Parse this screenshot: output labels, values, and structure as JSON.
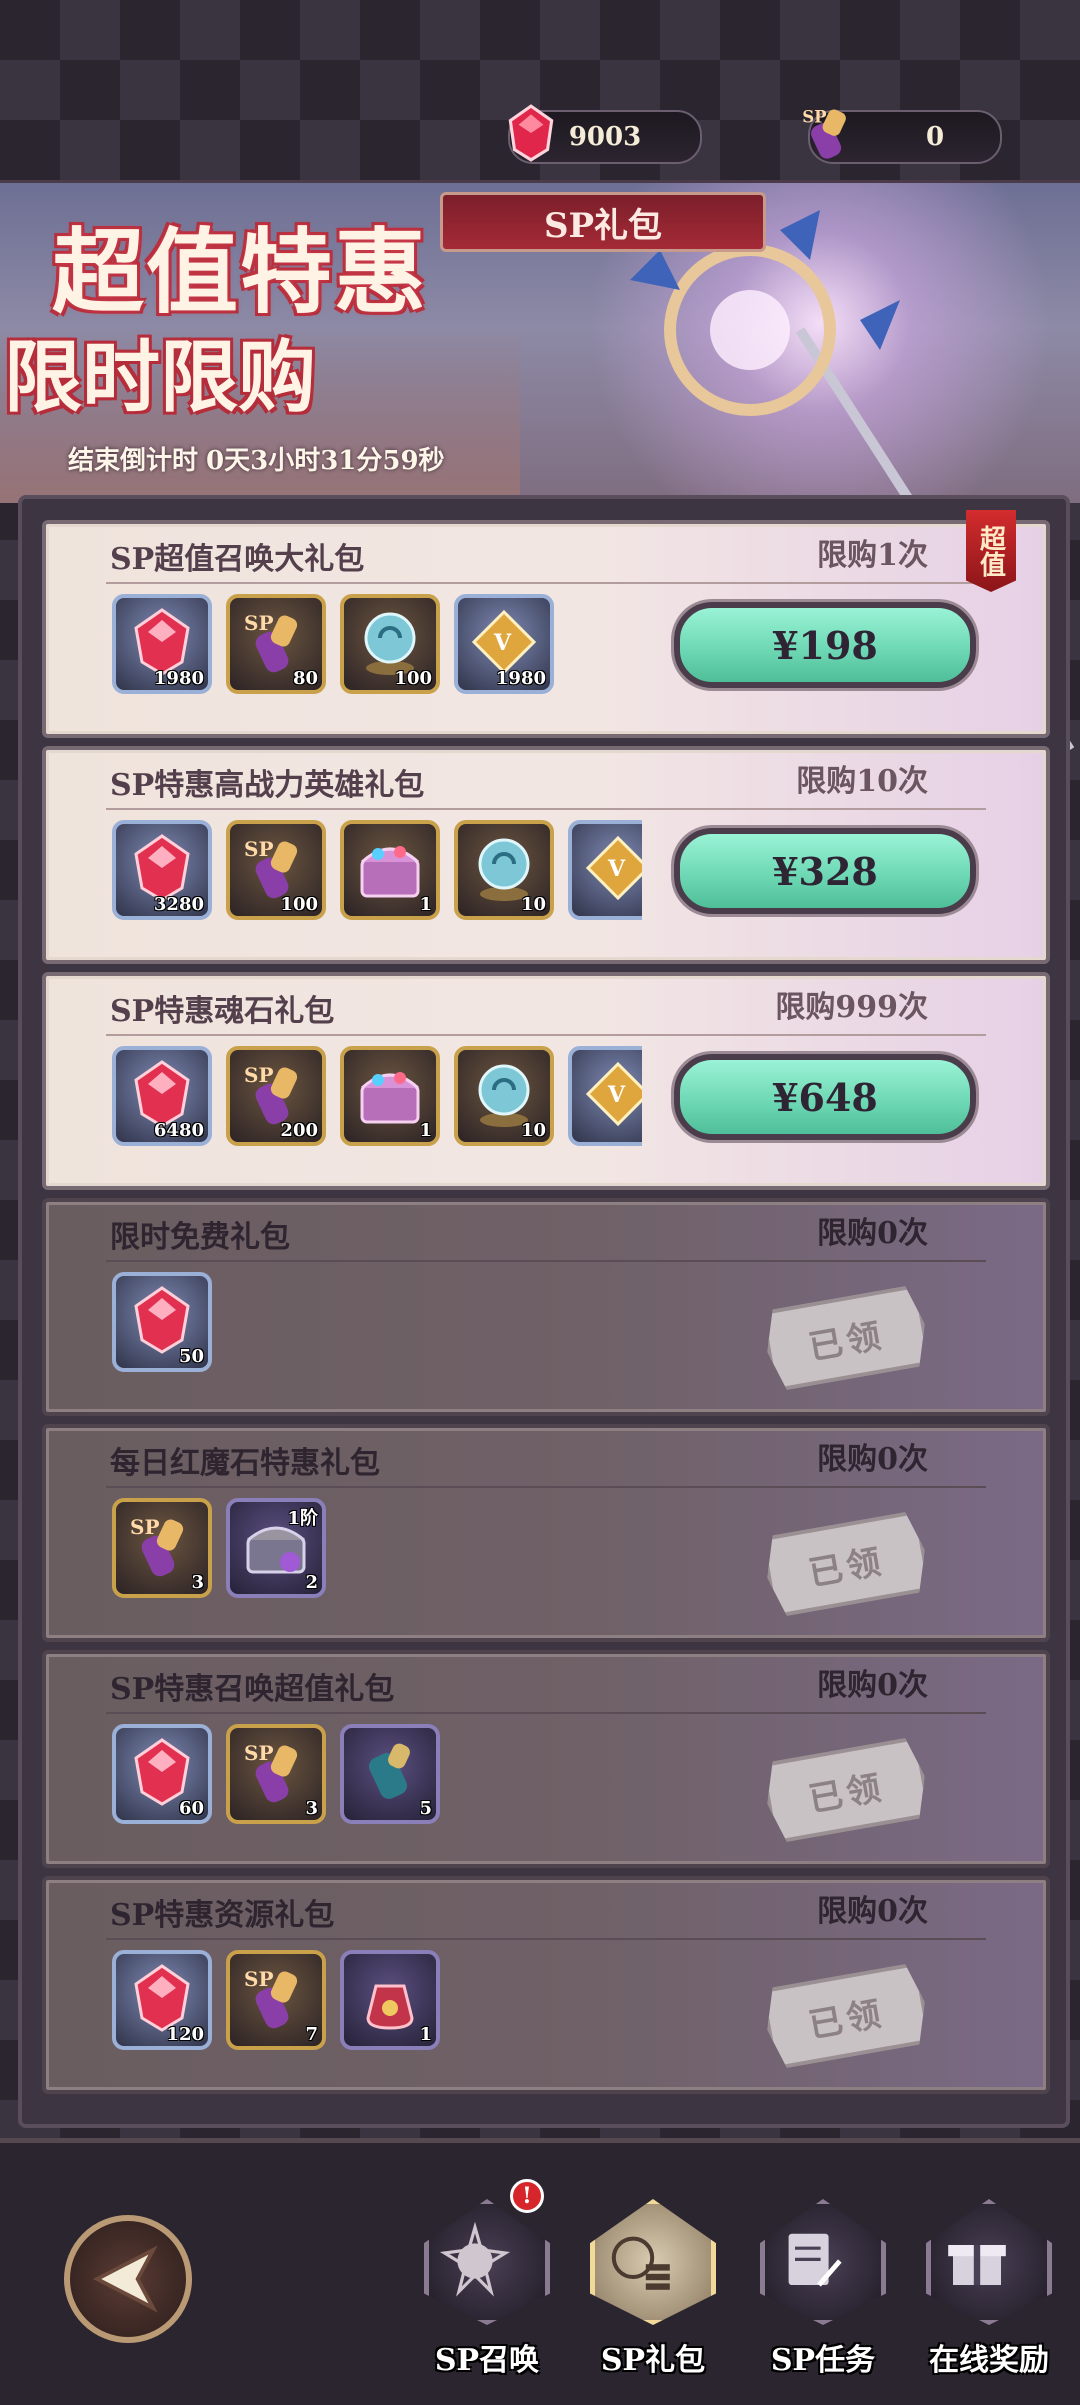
{
  "currency": {
    "red_gem": "9003",
    "sp_ticket": "0"
  },
  "banner": {
    "headline": "超值特惠",
    "subline": "限时限购",
    "tab_label": "SP礼包",
    "countdown_label": "结束倒计时",
    "countdown_value": "0天3小时31分59秒"
  },
  "packs": [
    {
      "title": "SP超值召唤大礼包",
      "limit": "限购1次",
      "ribbon": "超值",
      "status": "active",
      "price": "¥198",
      "items": [
        {
          "icon": "red-gem-icon",
          "qty": "1980"
        },
        {
          "icon": "sp-scroll-icon",
          "qty": "80"
        },
        {
          "icon": "spirit-orb-icon",
          "qty": "100"
        },
        {
          "icon": "gold-crystal-icon",
          "qty": "1980"
        }
      ]
    },
    {
      "title": "SP特惠高战力英雄礼包",
      "limit": "限购10次",
      "status": "active",
      "price": "¥328",
      "items": [
        {
          "icon": "red-gem-icon",
          "qty": "3280"
        },
        {
          "icon": "sp-scroll-icon",
          "qty": "100"
        },
        {
          "icon": "treasure-chest-icon",
          "qty": "1"
        },
        {
          "icon": "spirit-orb-icon",
          "qty": "10"
        },
        {
          "icon": "gold-crystal-icon",
          "qty": ""
        }
      ]
    },
    {
      "title": "SP特惠魂石礼包",
      "limit": "限购999次",
      "status": "active",
      "price": "¥648",
      "items": [
        {
          "icon": "red-gem-icon",
          "qty": "6480"
        },
        {
          "icon": "sp-scroll-icon",
          "qty": "200"
        },
        {
          "icon": "treasure-chest-icon",
          "qty": "1"
        },
        {
          "icon": "spirit-orb-icon",
          "qty": "10"
        },
        {
          "icon": "gold-crystal-icon",
          "qty": ""
        }
      ]
    },
    {
      "title": "限时免费礼包",
      "limit": "限购0次",
      "status": "claimed",
      "claimed_label": "已领",
      "items": [
        {
          "icon": "red-gem-icon",
          "qty": "50"
        }
      ]
    },
    {
      "title": "每日红魔石特惠礼包",
      "limit": "限购0次",
      "status": "claimed",
      "claimed_label": "已领",
      "items": [
        {
          "icon": "sp-scroll-icon",
          "qty": "3"
        },
        {
          "icon": "tier1-chest-icon",
          "qty": "2",
          "tier": "1阶"
        }
      ]
    },
    {
      "title": "SP特惠召唤超值礼包",
      "limit": "限购0次",
      "status": "claimed",
      "claimed_label": "已领",
      "items": [
        {
          "icon": "red-gem-icon",
          "qty": "60"
        },
        {
          "icon": "sp-scroll-icon",
          "qty": "3"
        },
        {
          "icon": "blue-scroll-icon",
          "qty": "5"
        }
      ]
    },
    {
      "title": "SP特惠资源礼包",
      "limit": "限购0次",
      "status": "claimed",
      "claimed_label": "已领",
      "items": [
        {
          "icon": "red-gem-icon",
          "qty": "120"
        },
        {
          "icon": "sp-scroll-icon",
          "qty": "7"
        },
        {
          "icon": "coin-pouch-icon",
          "qty": "1"
        }
      ]
    }
  ],
  "nav": [
    {
      "label": "SP召唤",
      "icon": "summon-icon",
      "badge": "!"
    },
    {
      "label": "SP礼包",
      "icon": "gift-pack-icon",
      "active": true
    },
    {
      "label": "SP任务",
      "icon": "task-icon"
    },
    {
      "label": "在线奖励",
      "icon": "online-reward-icon"
    }
  ],
  "colors": {
    "price_button": "#6bd6b2",
    "ribbon_red": "#d32c2e",
    "headline_stroke": "#b52c3a"
  }
}
